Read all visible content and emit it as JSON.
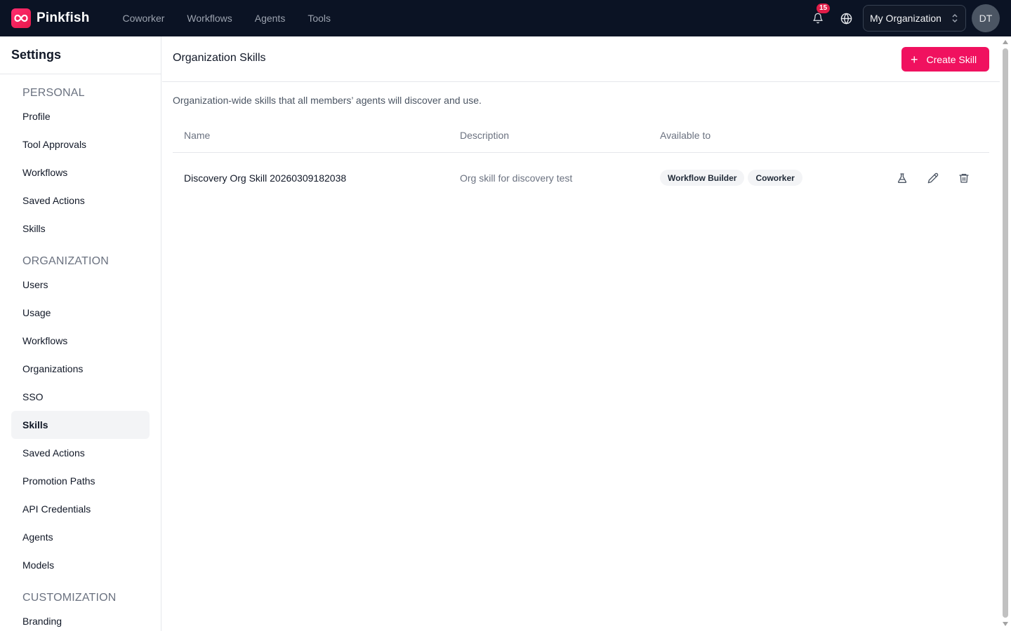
{
  "app": {
    "name": "Pinkfish"
  },
  "topnav": {
    "items": [
      "Coworker",
      "Workflows",
      "Agents",
      "Tools"
    ]
  },
  "notifications": {
    "count": "15"
  },
  "org_select": {
    "value": "My Organization"
  },
  "user": {
    "initials": "DT"
  },
  "sidebar": {
    "title": "Settings",
    "personal": {
      "title": "PERSONAL",
      "items": [
        "Profile",
        "Tool Approvals",
        "Workflows",
        "Saved Actions",
        "Skills"
      ]
    },
    "organization": {
      "title": "ORGANIZATION",
      "items": [
        "Users",
        "Usage",
        "Workflows",
        "Organizations",
        "SSO",
        "Skills",
        "Saved Actions",
        "Promotion Paths",
        "API Credentials",
        "Agents",
        "Models"
      ]
    },
    "customization": {
      "title": "CUSTOMIZATION",
      "items": [
        "Branding"
      ]
    },
    "active": "organization.Skills"
  },
  "main": {
    "title": "Organization Skills",
    "create_label": "Create Skill",
    "subtitle": "Organization-wide skills that all members’ agents will discover and use.",
    "columns": {
      "name": "Name",
      "description": "Description",
      "available": "Available to"
    },
    "rows": [
      {
        "name": "Discovery Org Skill 20260309182038",
        "description": "Org skill for discovery test",
        "available_to": [
          "Workflow Builder",
          "Coworker"
        ]
      }
    ]
  },
  "colors": {
    "topbar": "#0b1324",
    "accent": "#f0115f",
    "badge": "#e11d48"
  },
  "icons": [
    "infinity-logo-icon",
    "bell-icon",
    "globe-icon",
    "chevron-up-down-icon",
    "plus-icon",
    "flask-icon",
    "pencil-icon",
    "trash-icon"
  ]
}
